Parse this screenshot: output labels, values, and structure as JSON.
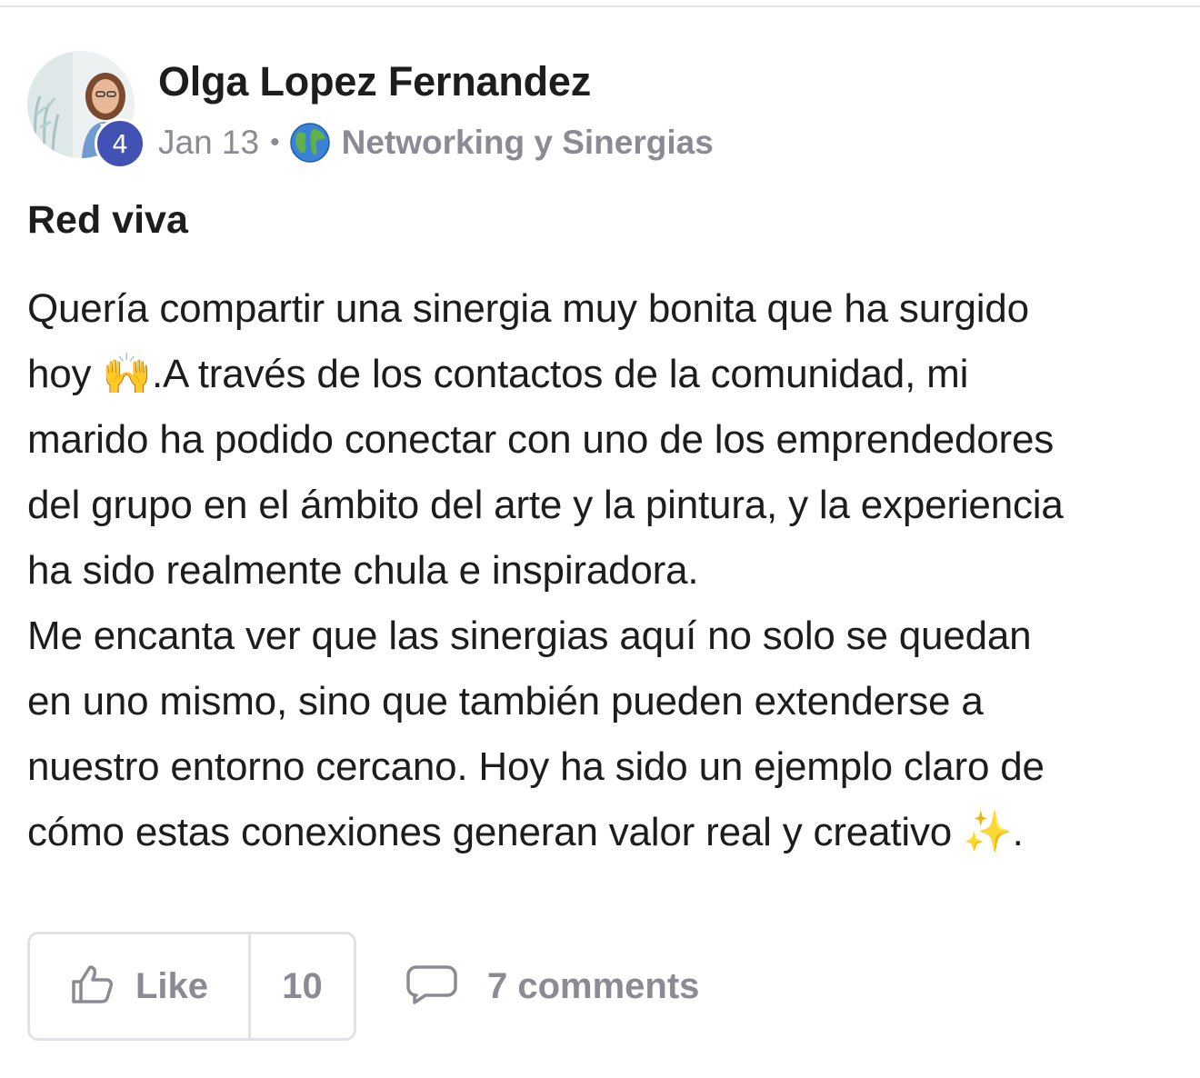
{
  "author": {
    "name": "Olga Lopez Fernandez",
    "level": "4"
  },
  "meta": {
    "date": "Jan 13",
    "separator": "•",
    "space_icon": "globe-icon",
    "space_name": "Networking y Sinergias"
  },
  "post": {
    "title": "Red viva",
    "lines": [
      {
        "text": "Quería compartir una sinergia muy bonita que ha surgido"
      },
      {
        "before": "hoy ",
        "emoji": "🙌",
        "after": ".A través de los contactos de la comunidad, mi"
      },
      {
        "text": "marido ha podido conectar con uno de los emprendedores"
      },
      {
        "text": "del grupo en el ámbito del arte y la pintura, y la experiencia"
      },
      {
        "text": "ha sido realmente chula e inspiradora."
      },
      {
        "text": "Me encanta ver que las sinergias aquí no solo se quedan"
      },
      {
        "text": "en uno mismo, sino que también pueden extenderse a"
      },
      {
        "text": "nuestro entorno cercano. Hoy ha sido un ejemplo claro de"
      },
      {
        "before": "cómo estas conexiones generan valor real y creativo ",
        "emoji": "✨",
        "after": "."
      }
    ]
  },
  "actions": {
    "like_label": "Like",
    "like_count": "10",
    "comments_label": "7 comments"
  },
  "colors": {
    "badge": "#4151b4",
    "muted": "#8b8b93",
    "text": "#1d1d1f",
    "border": "#e2e2e6"
  }
}
